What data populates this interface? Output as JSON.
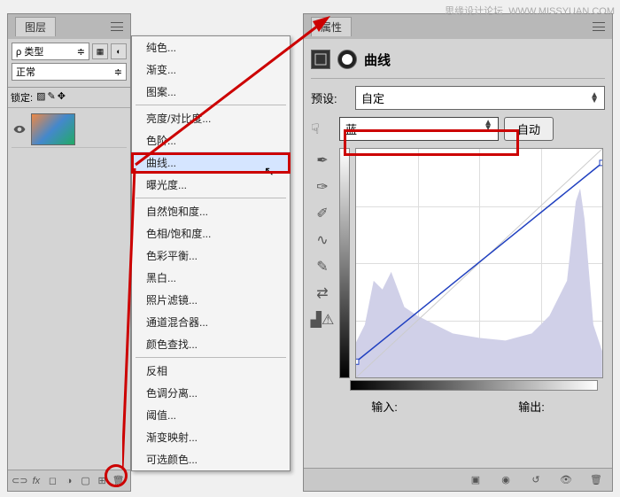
{
  "watermark": {
    "text1": "思缘设计论坛",
    "text2": "WWW.MISSYUAN.COM"
  },
  "layers_panel": {
    "title": "图层",
    "type_label": "类型",
    "blend_mode": "正常",
    "lock_label": "锁定:"
  },
  "context_menu": {
    "items_g1": [
      "纯色...",
      "渐变...",
      "图案..."
    ],
    "items_g2": [
      "亮度/对比度...",
      "色阶...",
      "曲线...",
      "曝光度..."
    ],
    "items_g3": [
      "自然饱和度...",
      "色相/饱和度...",
      "色彩平衡...",
      "黑白...",
      "照片滤镜...",
      "通道混合器...",
      "颜色查找..."
    ],
    "items_g4": [
      "反相",
      "色调分离...",
      "阈值...",
      "渐变映射...",
      "可选颜色..."
    ],
    "highlighted": "曲线..."
  },
  "props_panel": {
    "title": "属性",
    "adjust_name": "曲线",
    "preset_label": "预设:",
    "preset_value": "自定",
    "channel_value": "蓝",
    "auto_label": "自动",
    "input_label": "输入:",
    "output_label": "输出:"
  },
  "chart_data": {
    "type": "line",
    "title": "曲线",
    "xlabel": "输入",
    "ylabel": "输出",
    "xlim": [
      0,
      255
    ],
    "ylim": [
      0,
      255
    ],
    "series": [
      {
        "name": "蓝",
        "points": [
          [
            0,
            18
          ],
          [
            255,
            240
          ]
        ]
      }
    ],
    "grid": "4x4"
  }
}
